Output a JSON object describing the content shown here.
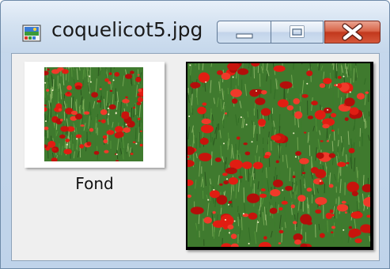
{
  "window": {
    "title": "coquelicot5.jpg",
    "app_icon": "image-file-icon",
    "controls": {
      "minimize_icon": "minimize-icon",
      "maximize_icon": "maximize-icon",
      "close_icon": "close-icon"
    }
  },
  "thumbnails": [
    {
      "label": "Fond",
      "image": "poppy-field-thumbnail"
    }
  ],
  "preview": {
    "image": "poppy-field-preview"
  },
  "colors": {
    "grass": "#3f7a2e",
    "poppy": "#e11d12",
    "close_button": "#c2381d"
  }
}
